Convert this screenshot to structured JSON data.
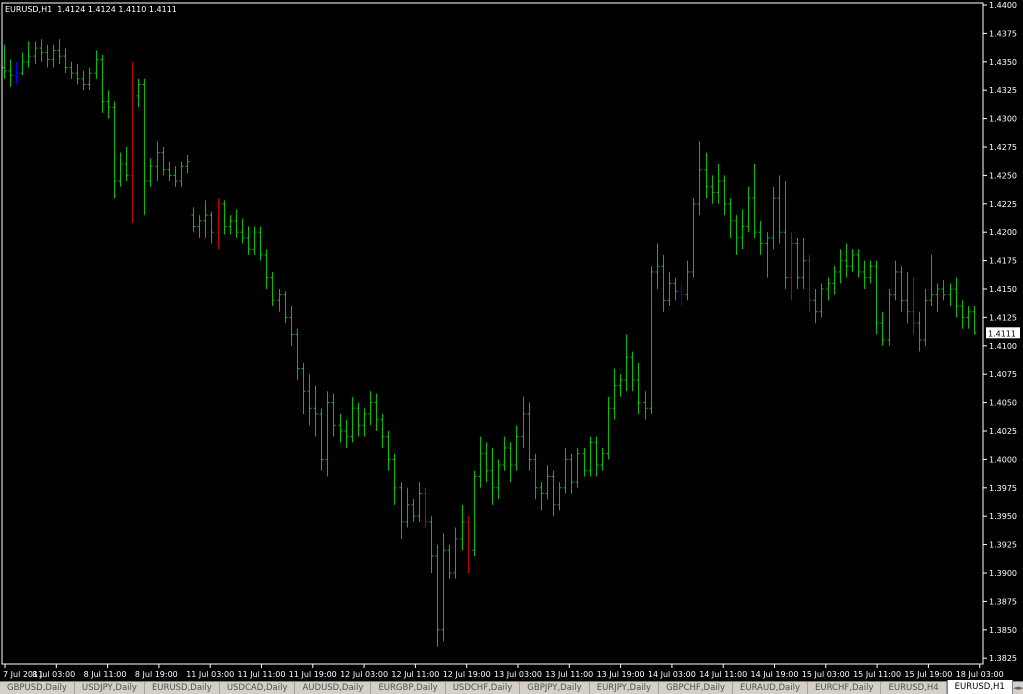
{
  "chart_data": {
    "type": "ohlc",
    "header_text": "EURUSD,H1  1.4124 1.4124 1.4110 1.4111",
    "ylim": [
      1.3815,
      1.44
    ],
    "y_ticks": [
      "1.4400",
      "1.4375",
      "1.4350",
      "1.4325",
      "1.4300",
      "1.4275",
      "1.4250",
      "1.4225",
      "1.4200",
      "1.4175",
      "1.4150",
      "1.4125",
      "1.4100",
      "1.4075",
      "1.4050",
      "1.4025",
      "1.4000",
      "1.3975",
      "1.3950",
      "1.3925",
      "1.3900",
      "1.3875",
      "1.3850",
      "1.3825"
    ],
    "x_ticks": [
      "7 Jul 2011",
      "8 Jul 03:00",
      "8 Jul 11:00",
      "8 Jul 19:00",
      "11 Jul 03:00",
      "11 Jul 11:00",
      "11 Jul 19:00",
      "12 Jul 03:00",
      "12 Jul 11:00",
      "12 Jul 19:00",
      "13 Jul 03:00",
      "13 Jul 11:00",
      "13 Jul 19:00",
      "14 Jul 03:00",
      "14 Jul 11:00",
      "14 Jul 19:00",
      "15 Jul 03:00",
      "15 Jul 11:00",
      "15 Jul 19:00",
      "18 Jul 03:00"
    ],
    "current_price": "1.4111",
    "colors": {
      "up": "#00c000",
      "down": "#00c000",
      "doji": "#0000ff",
      "highlight": "#c00000",
      "axis": "#ffffff",
      "background": "#000000"
    },
    "bars": [
      [
        1.4345,
        1.4365,
        1.4335,
        1.4342
      ],
      [
        1.4342,
        1.4352,
        1.4328,
        1.4338
      ],
      [
        1.4338,
        1.435,
        1.433,
        1.434
      ],
      [
        1.434,
        1.4358,
        1.4338,
        1.435
      ],
      [
        1.435,
        1.4368,
        1.4345,
        1.4355
      ],
      [
        1.4355,
        1.4368,
        1.4348,
        1.4362
      ],
      [
        1.4362,
        1.437,
        1.435,
        1.4358
      ],
      [
        1.4358,
        1.4365,
        1.4345,
        1.4352
      ],
      [
        1.4352,
        1.4365,
        1.4345,
        1.436
      ],
      [
        1.436,
        1.437,
        1.4348,
        1.4355
      ],
      [
        1.4355,
        1.4362,
        1.434,
        1.4345
      ],
      [
        1.4345,
        1.435,
        1.4335,
        1.434
      ],
      [
        1.434,
        1.4348,
        1.433,
        1.4335
      ],
      [
        1.4335,
        1.4342,
        1.4325,
        1.433
      ],
      [
        1.433,
        1.4345,
        1.4325,
        1.434
      ],
      [
        1.434,
        1.436,
        1.4335,
        1.4352
      ],
      [
        1.4352,
        1.4356,
        1.4305,
        1.4315
      ],
      [
        1.4315,
        1.4325,
        1.43,
        1.431
      ],
      [
        1.431,
        1.4315,
        1.423,
        1.4245
      ],
      [
        1.4245,
        1.427,
        1.424,
        1.426
      ],
      [
        1.426,
        1.4275,
        1.4245,
        1.425
      ],
      [
        1.425,
        1.435,
        1.4208,
        1.432
      ],
      [
        1.432,
        1.4335,
        1.431,
        1.433
      ],
      [
        1.433,
        1.4335,
        1.4215,
        1.4245
      ],
      [
        1.4245,
        1.4265,
        1.424,
        1.4258
      ],
      [
        1.4258,
        1.428,
        1.4245,
        1.427
      ],
      [
        1.427,
        1.4275,
        1.425,
        1.4255
      ],
      [
        1.4255,
        1.4262,
        1.4245,
        1.425
      ],
      [
        1.425,
        1.4258,
        1.424,
        1.4245
      ],
      [
        1.4245,
        1.4262,
        1.424,
        1.4258
      ],
      [
        1.4258,
        1.4268,
        1.4252,
        1.4262
      ],
      [
        1.4215,
        1.4222,
        1.42,
        1.4205
      ],
      [
        1.4205,
        1.4215,
        1.4195,
        1.421
      ],
      [
        1.421,
        1.4228,
        1.4195,
        1.4215
      ],
      [
        1.4215,
        1.4218,
        1.419,
        1.42
      ],
      [
        1.42,
        1.423,
        1.4185,
        1.4225
      ],
      [
        1.4225,
        1.4228,
        1.4198,
        1.4205
      ],
      [
        1.4205,
        1.4215,
        1.4198,
        1.421
      ],
      [
        1.421,
        1.422,
        1.4195,
        1.42
      ],
      [
        1.42,
        1.4212,
        1.419,
        1.4195
      ],
      [
        1.4195,
        1.4205,
        1.418,
        1.4185
      ],
      [
        1.4185,
        1.4205,
        1.418,
        1.42
      ],
      [
        1.42,
        1.4205,
        1.4175,
        1.418
      ],
      [
        1.418,
        1.4185,
        1.415,
        1.416
      ],
      [
        1.416,
        1.4165,
        1.4135,
        1.414
      ],
      [
        1.414,
        1.415,
        1.413,
        1.4145
      ],
      [
        1.4145,
        1.4148,
        1.412,
        1.4125
      ],
      [
        1.4125,
        1.4135,
        1.41,
        1.411
      ],
      [
        1.411,
        1.4115,
        1.407,
        1.408
      ],
      [
        1.408,
        1.4085,
        1.404,
        1.406
      ],
      [
        1.406,
        1.4075,
        1.403,
        1.4045
      ],
      [
        1.4045,
        1.4065,
        1.402,
        1.404
      ],
      [
        1.404,
        1.4045,
        1.399,
        1.4
      ],
      [
        1.4,
        1.406,
        1.3985,
        1.405
      ],
      [
        1.405,
        1.4058,
        1.402,
        1.403
      ],
      [
        1.403,
        1.404,
        1.4015,
        1.4025
      ],
      [
        1.4025,
        1.4035,
        1.401,
        1.402
      ],
      [
        1.402,
        1.4055,
        1.4015,
        1.4045
      ],
      [
        1.4045,
        1.405,
        1.402,
        1.403
      ],
      [
        1.403,
        1.4045,
        1.402,
        1.404
      ],
      [
        1.404,
        1.406,
        1.403,
        1.405
      ],
      [
        1.405,
        1.4058,
        1.4025,
        1.4035
      ],
      [
        1.4035,
        1.404,
        1.401,
        1.402
      ],
      [
        1.402,
        1.4025,
        1.399,
        1.4
      ],
      [
        1.4,
        1.4005,
        1.396,
        1.3975
      ],
      [
        1.3975,
        1.398,
        1.393,
        1.3945
      ],
      [
        1.3945,
        1.3975,
        1.394,
        1.396
      ],
      [
        1.396,
        1.3965,
        1.3945,
        1.395
      ],
      [
        1.395,
        1.398,
        1.3945,
        1.397
      ],
      [
        1.397,
        1.3975,
        1.394,
        1.3945
      ],
      [
        1.3945,
        1.395,
        1.39,
        1.3915
      ],
      [
        1.3915,
        1.3925,
        1.3835,
        1.385
      ],
      [
        1.385,
        1.3935,
        1.384,
        1.392
      ],
      [
        1.392,
        1.3925,
        1.3895,
        1.39
      ],
      [
        1.39,
        1.394,
        1.3895,
        1.393
      ],
      [
        1.393,
        1.396,
        1.392,
        1.3945
      ],
      [
        1.3945,
        1.395,
        1.39,
        1.392
      ],
      [
        1.392,
        1.399,
        1.3915,
        1.3985
      ],
      [
        1.3985,
        1.402,
        1.3975,
        1.4005
      ],
      [
        1.4005,
        1.4015,
        1.398,
        1.399
      ],
      [
        1.399,
        1.401,
        1.396,
        1.3975
      ],
      [
        1.3975,
        1.4,
        1.3965,
        1.3995
      ],
      [
        1.3995,
        1.402,
        1.399,
        1.401
      ],
      [
        1.401,
        1.4015,
        1.398,
        1.3995
      ],
      [
        1.3995,
        1.403,
        1.399,
        1.402
      ],
      [
        1.402,
        1.4055,
        1.401,
        1.404
      ],
      [
        1.404,
        1.405,
        1.399,
        1.4
      ],
      [
        1.4,
        1.4005,
        1.3965,
        1.3975
      ],
      [
        1.3975,
        1.398,
        1.3955,
        1.397
      ],
      [
        1.397,
        1.3995,
        1.3965,
        1.3985
      ],
      [
        1.3985,
        1.399,
        1.395,
        1.396
      ],
      [
        1.396,
        1.398,
        1.3955,
        1.3975
      ],
      [
        1.3975,
        1.401,
        1.397,
        1.4
      ],
      [
        1.4,
        1.4005,
        1.397,
        1.398
      ],
      [
        1.398,
        1.401,
        1.3975,
        1.4005
      ],
      [
        1.4005,
        1.401,
        1.3985,
        1.399
      ],
      [
        1.399,
        1.402,
        1.3985,
        1.4015
      ],
      [
        1.4015,
        1.402,
        1.3985,
        1.3995
      ],
      [
        1.3995,
        1.401,
        1.399,
        1.4005
      ],
      [
        1.4005,
        1.4055,
        1.4,
        1.4045
      ],
      [
        1.4045,
        1.408,
        1.4035,
        1.4065
      ],
      [
        1.4065,
        1.4075,
        1.4055,
        1.407
      ],
      [
        1.407,
        1.411,
        1.406,
        1.409
      ],
      [
        1.409,
        1.4095,
        1.406,
        1.407
      ],
      [
        1.407,
        1.4085,
        1.404,
        1.405
      ],
      [
        1.405,
        1.406,
        1.4035,
        1.4045
      ],
      [
        1.4045,
        1.417,
        1.404,
        1.4165
      ],
      [
        1.4165,
        1.419,
        1.415,
        1.417
      ],
      [
        1.417,
        1.418,
        1.413,
        1.414
      ],
      [
        1.414,
        1.4165,
        1.4135,
        1.4155
      ],
      [
        1.4155,
        1.416,
        1.414,
        1.4148
      ],
      [
        1.4148,
        1.4155,
        1.4135,
        1.4145
      ],
      [
        1.4145,
        1.4175,
        1.414,
        1.4165
      ],
      [
        1.4165,
        1.423,
        1.416,
        1.4225
      ],
      [
        1.4225,
        1.428,
        1.4215,
        1.4255
      ],
      [
        1.4255,
        1.427,
        1.423,
        1.424
      ],
      [
        1.424,
        1.425,
        1.4225,
        1.4235
      ],
      [
        1.4235,
        1.426,
        1.4225,
        1.4245
      ],
      [
        1.4245,
        1.425,
        1.4215,
        1.4225
      ],
      [
        1.4225,
        1.423,
        1.4195,
        1.421
      ],
      [
        1.421,
        1.4215,
        1.418,
        1.4195
      ],
      [
        1.4195,
        1.422,
        1.4185,
        1.4205
      ],
      [
        1.4205,
        1.424,
        1.42,
        1.423
      ],
      [
        1.423,
        1.426,
        1.4195,
        1.42
      ],
      [
        1.42,
        1.421,
        1.418,
        1.419
      ],
      [
        1.419,
        1.42,
        1.416,
        1.4195
      ],
      [
        1.4195,
        1.424,
        1.4185,
        1.423
      ],
      [
        1.423,
        1.425,
        1.419,
        1.42
      ],
      [
        1.42,
        1.4245,
        1.415,
        1.416
      ],
      [
        1.416,
        1.42,
        1.414,
        1.419
      ],
      [
        1.419,
        1.4195,
        1.415,
        1.416
      ],
      [
        1.416,
        1.4195,
        1.415,
        1.4175
      ],
      [
        1.4175,
        1.418,
        1.413,
        1.414
      ],
      [
        1.414,
        1.415,
        1.412,
        1.413
      ],
      [
        1.413,
        1.4155,
        1.4125,
        1.415
      ],
      [
        1.415,
        1.416,
        1.414,
        1.4155
      ],
      [
        1.4155,
        1.417,
        1.4145,
        1.4165
      ],
      [
        1.4165,
        1.4185,
        1.4155,
        1.4175
      ],
      [
        1.4175,
        1.419,
        1.416,
        1.417
      ],
      [
        1.417,
        1.4185,
        1.4165,
        1.418
      ],
      [
        1.418,
        1.4185,
        1.416,
        1.4165
      ],
      [
        1.4165,
        1.4175,
        1.415,
        1.416
      ],
      [
        1.416,
        1.4175,
        1.4155,
        1.417
      ],
      [
        1.417,
        1.4175,
        1.411,
        1.412
      ],
      [
        1.412,
        1.413,
        1.41,
        1.4105
      ],
      [
        1.4105,
        1.415,
        1.41,
        1.4145
      ],
      [
        1.4145,
        1.4175,
        1.414,
        1.4165
      ],
      [
        1.4165,
        1.417,
        1.413,
        1.414
      ],
      [
        1.414,
        1.4165,
        1.412,
        1.413
      ],
      [
        1.413,
        1.416,
        1.411,
        1.412
      ],
      [
        1.412,
        1.413,
        1.4095,
        1.4105
      ],
      [
        1.4105,
        1.415,
        1.41,
        1.414
      ],
      [
        1.414,
        1.418,
        1.4135,
        1.4145
      ],
      [
        1.4145,
        1.4155,
        1.413,
        1.415
      ],
      [
        1.415,
        1.4158,
        1.414,
        1.4145
      ],
      [
        1.4145,
        1.4155,
        1.4135,
        1.415
      ],
      [
        1.415,
        1.416,
        1.4125,
        1.4135
      ],
      [
        1.4135,
        1.414,
        1.4115,
        1.4125
      ],
      [
        1.4125,
        1.4135,
        1.4115,
        1.413
      ],
      [
        1.413,
        1.4135,
        1.411,
        1.4111
      ]
    ]
  },
  "tabs": [
    "GBPUSD,Daily",
    "USDJPY,Daily",
    "EURUSD,Daily",
    "USDCAD,Daily",
    "AUDUSD,Daily",
    "EURGBP,Daily",
    "USDCHF,Daily",
    "GBPJPY,Daily",
    "EURJPY,Daily",
    "GBPCHF,Daily",
    "EURAUD,Daily",
    "EURCHF,Daily",
    "EURUSD,H4",
    "EURUSD,H1"
  ],
  "active_tab": "EURUSD,H1",
  "tab_scroll": {
    "left_icon": "◄",
    "right_icon": "►"
  }
}
